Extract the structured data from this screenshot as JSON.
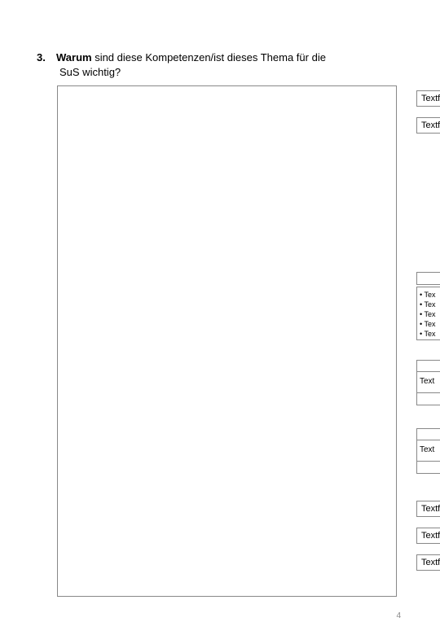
{
  "question": {
    "number": "3.",
    "bold_word": "Warum",
    "text_part1": " sind diese Kompetenzen/ist dieses Thema für die",
    "text_line2": "SuS wichtig?"
  },
  "side": {
    "textfel1": "Textfel",
    "textfel2": "Textfel",
    "bullets": [
      "Tex",
      "Tex",
      "Tex",
      "Tex",
      "Tex"
    ],
    "text_label1": "Text",
    "text_label2": "Text",
    "textf1": "Textf",
    "textf2": "Textf",
    "textf3": "Textf"
  },
  "page_number": "4"
}
